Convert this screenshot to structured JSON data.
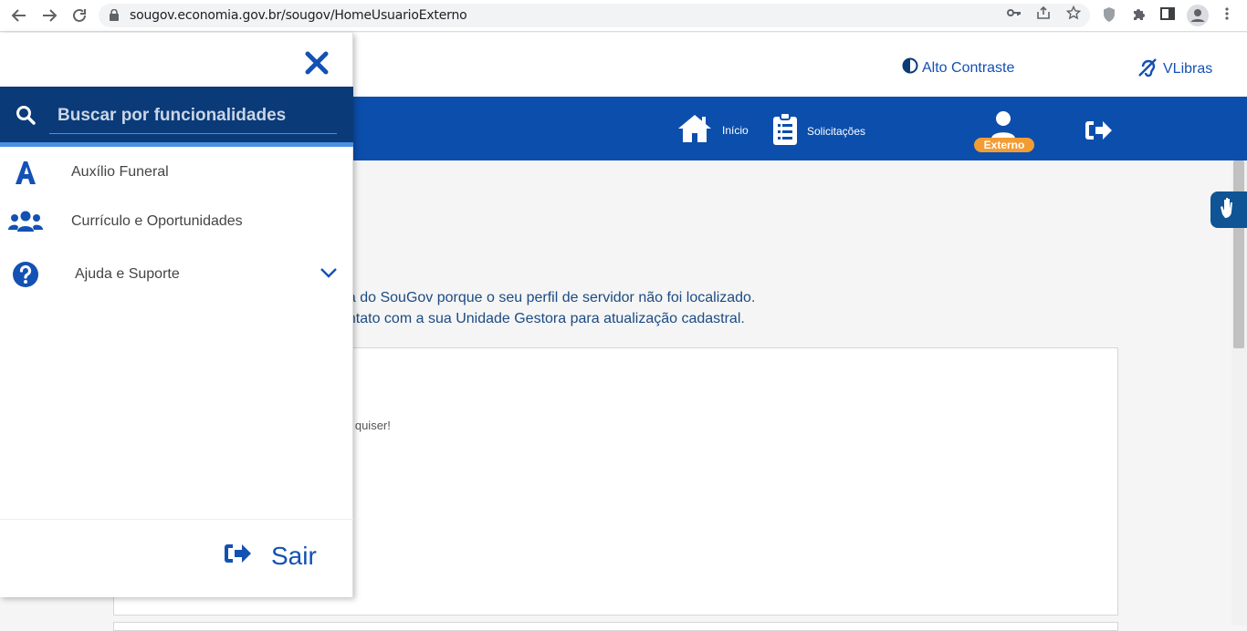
{
  "browser": {
    "url": "sougov.economia.gov.br/sougov/HomeUsuarioExterno"
  },
  "topbar": {
    "contrast_label": "Alto Contraste",
    "vlibras_label": "VLibras"
  },
  "navbar": {
    "items": [
      {
        "label": "Início"
      },
      {
        "label": "Solicitações"
      }
    ],
    "profile_badge": "Externo"
  },
  "content": {
    "message_line1": "na do SouGov porque o seu perfil de servidor não foi localizado.",
    "message_line2": "ontato com a sua Unidade Gestora para atualização cadastral.",
    "card_text": "e quiser!"
  },
  "sidemenu": {
    "search_placeholder": "Buscar por funcionalidades",
    "items": [
      {
        "label": "Auxílio Funeral",
        "icon": "letter-a-icon"
      },
      {
        "label": "Currículo e Oportunidades",
        "icon": "users-icon"
      },
      {
        "label": "Ajuda e Suporte",
        "icon": "help-circle-icon",
        "expandable": true
      }
    ],
    "logout_label": "Sair"
  },
  "colors": {
    "primary_blue": "#0c4eab",
    "search_bg": "#0a3a78",
    "badge_orange": "#f39c34",
    "link_blue": "#1351b4"
  }
}
